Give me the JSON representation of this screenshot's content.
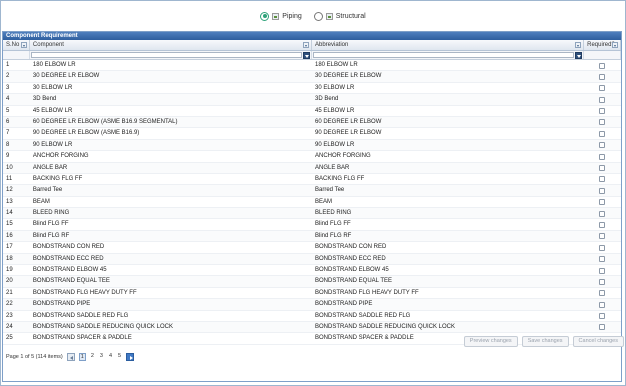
{
  "mode_options": [
    {
      "label": "Piping",
      "selected": true
    },
    {
      "label": "Structural",
      "selected": false
    }
  ],
  "panel": {
    "title": "Component Requirement"
  },
  "columns": {
    "sno": "S.No",
    "component": "Component",
    "abbreviation": "Abbreviation",
    "required": "Required?"
  },
  "rows": [
    {
      "sno": "1",
      "component": "180 ELBOW LR",
      "abbreviation": "180 ELBOW LR",
      "required": false
    },
    {
      "sno": "2",
      "component": "30 DEGREE LR ELBOW",
      "abbreviation": "30 DEGREE LR ELBOW",
      "required": false
    },
    {
      "sno": "3",
      "component": "30 ELBOW LR",
      "abbreviation": "30 ELBOW LR",
      "required": false
    },
    {
      "sno": "4",
      "component": "3D Bend",
      "abbreviation": "3D Bend",
      "required": false
    },
    {
      "sno": "5",
      "component": "45 ELBOW LR",
      "abbreviation": "45 ELBOW LR",
      "required": false
    },
    {
      "sno": "6",
      "component": "60 DEGREE LR ELBOW (ASME B16.9 SEGMENTAL)",
      "abbreviation": "60 DEGREE LR ELBOW",
      "required": false
    },
    {
      "sno": "7",
      "component": "90 DEGREE LR ELBOW (ASME B16.9)",
      "abbreviation": "90 DEGREE LR ELBOW",
      "required": false
    },
    {
      "sno": "8",
      "component": "90 ELBOW LR",
      "abbreviation": "90 ELBOW LR",
      "required": false
    },
    {
      "sno": "9",
      "component": "ANCHOR FORGING",
      "abbreviation": "ANCHOR FORGING",
      "required": false
    },
    {
      "sno": "10",
      "component": "ANGLE BAR",
      "abbreviation": "ANGLE BAR",
      "required": false
    },
    {
      "sno": "11",
      "component": "BACKING FLG FF",
      "abbreviation": "BACKING FLG FF",
      "required": false
    },
    {
      "sno": "12",
      "component": "Barred Tee",
      "abbreviation": "Barred Tee",
      "required": false
    },
    {
      "sno": "13",
      "component": "BEAM",
      "abbreviation": "BEAM",
      "required": false
    },
    {
      "sno": "14",
      "component": "BLEED RING",
      "abbreviation": "BLEED RING",
      "required": false
    },
    {
      "sno": "15",
      "component": "Blind FLG FF",
      "abbreviation": "Blind FLG FF",
      "required": false
    },
    {
      "sno": "16",
      "component": "Blind FLG RF",
      "abbreviation": "Blind FLG RF",
      "required": false
    },
    {
      "sno": "17",
      "component": "BONDSTRAND CON RED",
      "abbreviation": "BONDSTRAND CON RED",
      "required": false
    },
    {
      "sno": "18",
      "component": "BONDSTRAND ECC RED",
      "abbreviation": "BONDSTRAND ECC RED",
      "required": false
    },
    {
      "sno": "19",
      "component": "BONDSTRAND ELBOW 45",
      "abbreviation": "BONDSTRAND ELBOW 45",
      "required": false
    },
    {
      "sno": "20",
      "component": "BONDSTRAND EQUAL TEE",
      "abbreviation": "BONDSTRAND EQUAL TEE",
      "required": false
    },
    {
      "sno": "21",
      "component": "BONDSTRAND FLG HEAVY DUTY FF",
      "abbreviation": "BONDSTRAND FLG HEAVY DUTY FF",
      "required": false
    },
    {
      "sno": "22",
      "component": "BONDSTRAND PIPE",
      "abbreviation": "BONDSTRAND PIPE",
      "required": false
    },
    {
      "sno": "23",
      "component": "BONDSTRAND SADDLE RED FLG",
      "abbreviation": "BONDSTRAND SADDLE RED FLG",
      "required": false
    },
    {
      "sno": "24",
      "component": "BONDSTRAND SADDLE REDUCING QUICK LOCK",
      "abbreviation": "BONDSTRAND SADDLE REDUCING QUICK LOCK",
      "required": false
    },
    {
      "sno": "25",
      "component": "BONDSTRAND SPACER & PADDLE",
      "abbreviation": "BONDSTRAND SPACER & PADDLE",
      "required": false
    }
  ],
  "pager": {
    "summary": "Page 1 of 5 (114 items)",
    "pages": [
      "1",
      "2",
      "3",
      "4",
      "5"
    ],
    "current": "1"
  },
  "actions": {
    "preview": "Preview changes",
    "save": "Save changes",
    "cancel": "Cancel changes"
  },
  "colors": {
    "header": "#2f5f9f",
    "radio_selected": "#2ea37a"
  }
}
